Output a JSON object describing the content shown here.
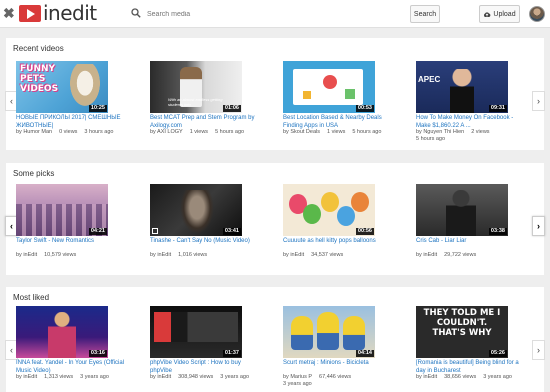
{
  "app": {
    "logo_text": "inedit",
    "close_glyph": "✖"
  },
  "search": {
    "placeholder": "Search media",
    "button_label": "Search"
  },
  "upload": {
    "label": "Upload",
    "icon": "cloud-upload-icon"
  },
  "sections": [
    {
      "title": "Recent videos",
      "videos": [
        {
          "title": "НОВЫЕ ПРИКОЛЫ 2017| СМЕШНЫЕ ЖИВОТНЫЕ|",
          "author": "by Humor Man",
          "views": "0 views",
          "time": "3 hours ago",
          "duration": "10:25",
          "overlay": "FUNNY PETS VIDEOS"
        },
        {
          "title": "Best MCAT Prep and Stem Program by Axilogy.com",
          "author": "by AXI LOGY",
          "views": "1 views",
          "time": "5 hours ago",
          "duration": "01:06",
          "overlay": "With an almost endless getting students into"
        },
        {
          "title": "Best Location Based & Nearby Deals Finding Apps in USA",
          "author": "by Skout Deals",
          "views": "1 views",
          "time": "5 hours ago",
          "duration": "00:53",
          "overlay": ""
        },
        {
          "title": "How To Make Money On Facebook - Make $1,860.22 A ...",
          "author": "by Nguyen Thi Hien",
          "views": "2 views",
          "time": "5 hours ago",
          "duration": "09:31",
          "overlay": "APEC"
        }
      ]
    },
    {
      "title": "Some picks",
      "videos": [
        {
          "title": "Taylor Swift - New Romantics",
          "author": "by inEdit",
          "views": "10,579 views",
          "time": "",
          "duration": "04:21",
          "overlay": ""
        },
        {
          "title": "Tinashe - Can't Say No (Music Video)",
          "author": "by inEdit",
          "views": "1,016 views",
          "time": "",
          "duration": "03:41",
          "overlay": ""
        },
        {
          "title": "Cuuuute as hell kitty pops balloons",
          "author": "by inEdit",
          "views": "34,537 views",
          "time": "",
          "duration": "00:56",
          "overlay": ""
        },
        {
          "title": "Cris Cab - Liar Liar",
          "author": "by inEdit",
          "views": "29,722 views",
          "time": "",
          "duration": "03:38",
          "overlay": ""
        }
      ]
    },
    {
      "title": "Most liked",
      "videos": [
        {
          "title": "INNA feat. Yandel - In Your Eyes (Official Music Video)",
          "author": "by inEdit",
          "views": "1,313 views",
          "time": "3 years ago",
          "duration": "03:16",
          "overlay": ""
        },
        {
          "title": "phpVibe Video Script : How to buy phpVibe",
          "author": "by inEdit",
          "views": "308,948 views",
          "time": "3 years ago",
          "duration": "01:37",
          "overlay": ""
        },
        {
          "title": "Scurt metraj : Minions - Bicicleta",
          "author": "by Marius P",
          "views": "67,446 views",
          "time": "3 years ago",
          "duration": "04:14",
          "overlay": ""
        },
        {
          "title": "[Romania is beautiful] Being blind for a day in Bucharest",
          "author": "by inEdit",
          "views": "38,656 views",
          "time": "3 years ago",
          "duration": "05:26",
          "overlay": "THEY TOLD ME I COULDN'T. THAT'S WHY"
        }
      ]
    }
  ],
  "arrows": {
    "prev": "‹",
    "next": "›"
  },
  "colors": {
    "brand_red": "#d93a3a",
    "link_blue": "#1e74c0"
  }
}
